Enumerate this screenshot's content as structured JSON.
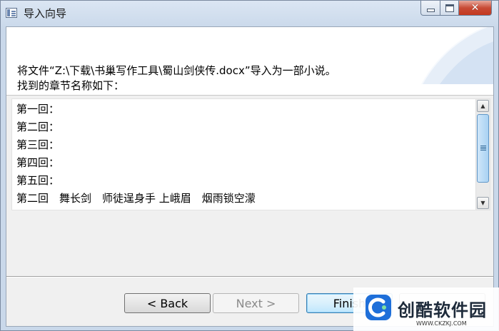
{
  "window": {
    "title": "导入向导"
  },
  "caption": {
    "minimize": "minimize",
    "maximize": "maximize",
    "close": "✕"
  },
  "description": {
    "line1": "将文件“Z:\\下载\\书巢写作工具\\蜀山剑侠传.docx”导入为一部小说。",
    "line2": "找到的章节名称如下："
  },
  "chapters": [
    "第一回：",
    "第二回：",
    "第三回：",
    "第四回：",
    "第五回：",
    "第二回　舞长剑　师徒逞身手 上峨眉　烟雨锁空濛"
  ],
  "scrollbar": {
    "up": "▲",
    "down": "▼"
  },
  "buttons": {
    "back": "< Back",
    "next": "Next >",
    "finish": "Finish",
    "cancel": ""
  },
  "watermark": {
    "brand": "创酷软件园",
    "url": "WWW.CKZKJ.COM"
  },
  "colors": {
    "accent": "#3c7fb1",
    "title_bar": "#c9d8ea",
    "close": "#c84b36"
  }
}
